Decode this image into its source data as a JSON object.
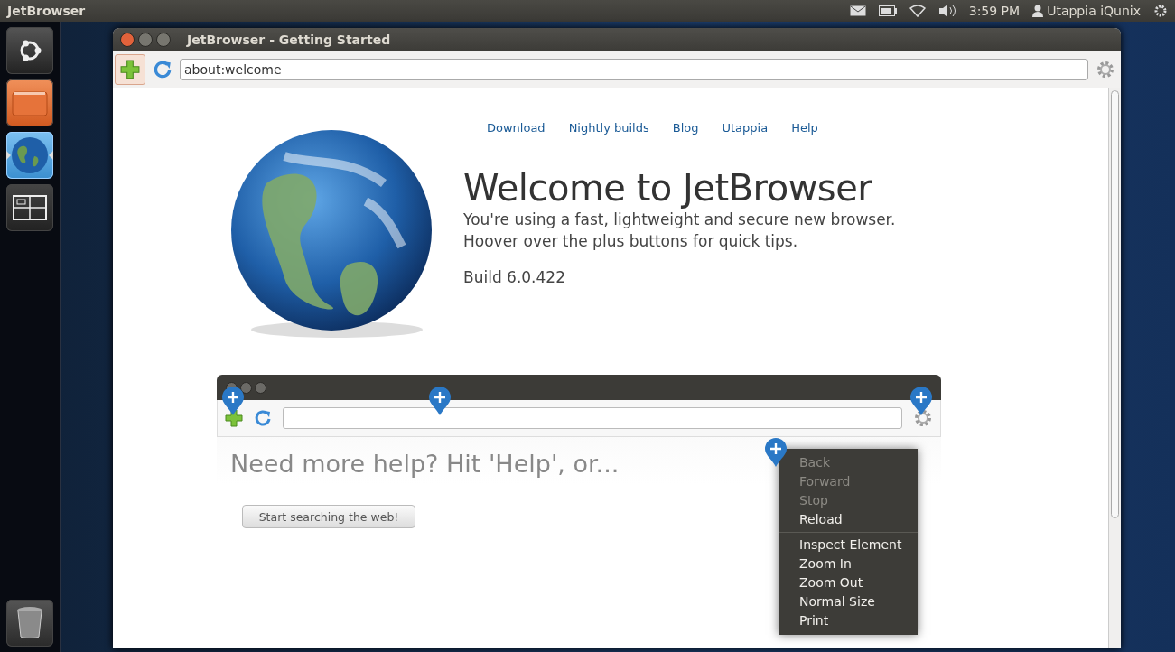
{
  "top_panel": {
    "app_name": "JetBrowser",
    "clock": "3:59 PM",
    "user": "Utappia iQunix"
  },
  "launcher": {
    "items": [
      {
        "kind": "dash",
        "selected": false
      },
      {
        "kind": "files",
        "selected": false
      },
      {
        "kind": "browser",
        "selected": true
      },
      {
        "kind": "workspaces",
        "selected": false
      },
      {
        "kind": "trash",
        "selected": false
      }
    ]
  },
  "window": {
    "title": "JetBrowser - Getting Started",
    "address": "about:welcome"
  },
  "page": {
    "nav_links": [
      "Download",
      "Nightly builds",
      "Blog",
      "Utappia",
      "Help"
    ],
    "heading": "Welcome to JetBrowser",
    "tagline_lines": [
      "You're using a fast, lightweight and secure new browser.",
      "Hoover over the plus buttons for quick tips."
    ],
    "build": "Build 6.0.422",
    "demo": {
      "heading": "Need more help? Hit 'Help', or...",
      "button": "Start searching the web!",
      "menu": [
        {
          "label": "Back",
          "disabled": true,
          "separator_after": false
        },
        {
          "label": "Forward",
          "disabled": true,
          "separator_after": false
        },
        {
          "label": "Stop",
          "disabled": true,
          "separator_after": false
        },
        {
          "label": "Reload",
          "disabled": false,
          "separator_after": true
        },
        {
          "label": "Inspect Element",
          "disabled": false,
          "separator_after": false
        },
        {
          "label": "Zoom In",
          "disabled": false,
          "separator_after": false
        },
        {
          "label": "Zoom Out",
          "disabled": false,
          "separator_after": false
        },
        {
          "label": "Normal Size",
          "disabled": false,
          "separator_after": false
        },
        {
          "label": "Print",
          "disabled": false,
          "separator_after": false
        }
      ]
    }
  }
}
